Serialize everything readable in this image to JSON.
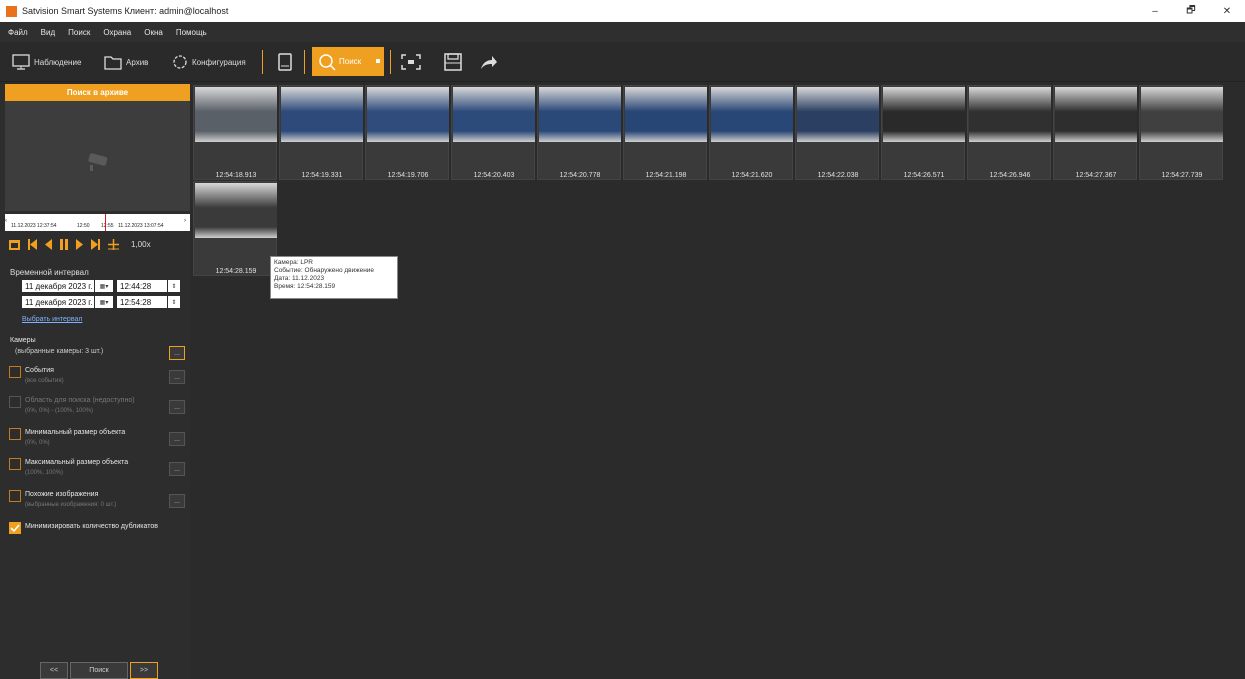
{
  "window": {
    "title": "Satvision Smart Systems Клиент: admin@localhost",
    "minimize": "–",
    "maximize": "🗗",
    "close": "✕"
  },
  "menu": [
    "Файл",
    "Вид",
    "Поиск",
    "Охрана",
    "Окна",
    "Помощь"
  ],
  "toolbar": {
    "monitoring": "Наблюдение",
    "archive": "Архив",
    "config": "Конфигурация",
    "search": "Поиск"
  },
  "panel": {
    "header": "Поиск в архиве",
    "timeline": {
      "start": "11.12.2023 12:37:54",
      "t1": "12:50",
      "t2": "12:55",
      "end": "11.12.2023 13:07:54"
    },
    "speed": "1,00x",
    "interval_label": "Временной интервал",
    "from_date": "11 декабря  2023 г.",
    "from_time": "12:44:28",
    "to_date": "11 декабря  2023 г.",
    "to_time": "12:54:28",
    "choose_interval": "Выбрать интервал",
    "cameras_label": "Камеры",
    "cameras_sub": "(выбранные камеры: 3 шт.)",
    "filters": [
      {
        "title": "События",
        "sub": "(все события)"
      },
      {
        "title": "Область для поиска (недоступно)",
        "sub": "(0%, 0%) - (100%, 100%)"
      },
      {
        "title": "Минимальный размер объекта",
        "sub": "(0%, 0%)"
      },
      {
        "title": "Максимальный размер объекта",
        "sub": "(100%, 100%)"
      },
      {
        "title": "Похожие изображения",
        "sub": "(выбранные изображения: 0 шт.)"
      }
    ],
    "dedupe": "Минимизировать количество дубликатов",
    "dots": "...",
    "prev": "<<",
    "search_btn": "Поиск",
    "next": ">>"
  },
  "results": [
    {
      "time": "12:54:18.913",
      "color": "#5a6068"
    },
    {
      "time": "12:54:19.331",
      "color": "#2d4a7a"
    },
    {
      "time": "12:54:19.706",
      "color": "#2f4c7c"
    },
    {
      "time": "12:54:20.403",
      "color": "#2c4a7a"
    },
    {
      "time": "12:54:20.778",
      "color": "#2a4878"
    },
    {
      "time": "12:54:21.198",
      "color": "#274575"
    },
    {
      "time": "12:54:21.620",
      "color": "#294776"
    },
    {
      "time": "12:54:22.038",
      "color": "#2b3f62"
    },
    {
      "time": "12:54:26.571",
      "color": "#2a2a2a"
    },
    {
      "time": "12:54:26.946",
      "color": "#303030"
    },
    {
      "time": "12:54:27.367",
      "color": "#2e2e2e"
    },
    {
      "time": "12:54:27.739",
      "color": "#404040"
    },
    {
      "time": "12:54:28.159",
      "color": "#3a3a3a"
    }
  ],
  "tooltip": {
    "camera": "Камера: LPR",
    "event": "Событие: Обнаружено движение",
    "date": "Дата: 11.12.2023",
    "time": "Время: 12:54:28.159"
  }
}
